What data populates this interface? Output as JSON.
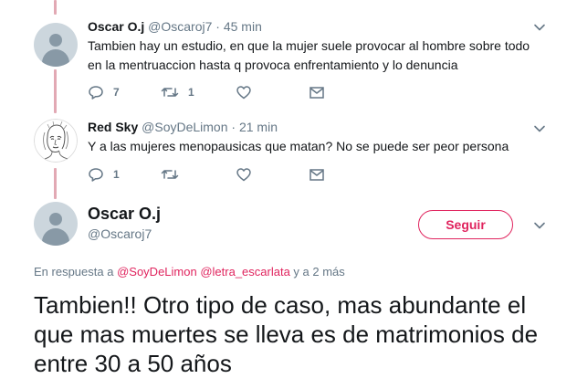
{
  "tweets": [
    {
      "name": "Oscar O.j",
      "handle": "@Oscaroj7",
      "separator": "·",
      "time": "45 min",
      "text": "Tambien hay un estudio, en que la mujer suele provocar al hombre sobre todo en la mentruaccion hasta q provoca enfrentamiento y lo denuncia",
      "reply_count": "7",
      "retweet_count": "1",
      "avatar": "default-avatar"
    },
    {
      "name": "Red Sky",
      "handle": "@SoyDeLimon",
      "separator": "·",
      "time": "21 min",
      "text": "Y a las mujeres menopausicas que matan? No se puede ser peor persona",
      "reply_count": "1",
      "avatar": "sketch-portrait-avatar"
    }
  ],
  "main_tweet": {
    "name": "Oscar O.j",
    "handle": "@Oscaroj7",
    "follow_label": "Seguir",
    "reply_prefix": "En respuesta a",
    "mention_1": "@SoyDeLimon",
    "mention_2": "@letra_escarlata",
    "reply_suffix": "y a 2 más",
    "text": "Tambien!! Otro tipo  de caso, mas abundante el que mas muertes se lleva es de matrimonios de entre 30 a 50 años"
  },
  "icons": {
    "reply": "reply-icon",
    "retweet": "retweet-icon",
    "like": "heart-icon",
    "dm": "envelope-icon",
    "menu": "chevron-down-icon"
  },
  "colors": {
    "accent": "#e0245e",
    "thread_line": "#e2a9b4",
    "muted": "#657786"
  }
}
